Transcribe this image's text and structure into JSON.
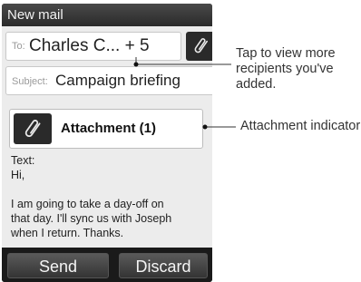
{
  "window": {
    "title": "New mail"
  },
  "to": {
    "label": "To:",
    "value": "Charles C... + 5"
  },
  "subject": {
    "label": "Subject:",
    "value": "Campaign briefing"
  },
  "attachment": {
    "label": "Attachment (1)"
  },
  "message": {
    "label": "Text:",
    "line1": "Hi,",
    "line2": "I am going to take a day-off on",
    "line3": "that day. I'll sync us with Joseph",
    "line4": "when I return. Thanks."
  },
  "actions": {
    "send": "Send",
    "discard": "Discard"
  },
  "annotations": {
    "recipients": "Tap to view more recipients you've added.",
    "attachment": "Attachment indicator"
  },
  "icons": {
    "attach": "paperclip-icon"
  }
}
